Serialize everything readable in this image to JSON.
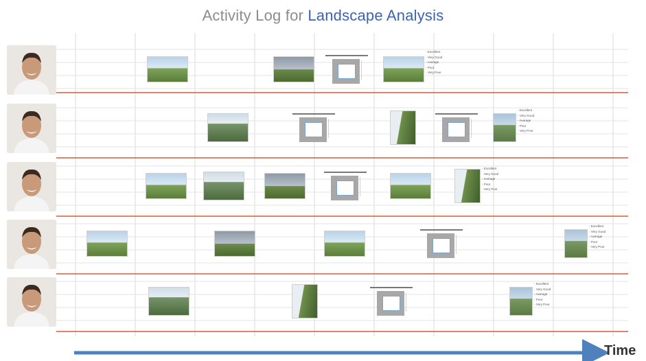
{
  "title": {
    "prefix": "Activity Log for ",
    "highlight": "Landscape Analysis"
  },
  "time_label": "Time",
  "colors": {
    "title_gray": "#8c8c8c",
    "title_blue": "#3a64b0",
    "separator_red": "#d9583b",
    "time_arrow": "#4f81bd",
    "grid": "#d9d9d9"
  },
  "rating_options": [
    "Excellent",
    "Very Good",
    "Average",
    "Poor",
    "Very Poor"
  ],
  "rows": [
    {
      "avatar": "man-smiling-avatar",
      "items": [
        {
          "kind": "photo",
          "scene": "land"
        },
        {
          "kind": "photo",
          "scene": "rain"
        },
        {
          "kind": "form"
        },
        {
          "kind": "photo",
          "scene": "land",
          "rating": true
        }
      ]
    },
    {
      "avatar": "woman-blonde-avatar",
      "items": [
        {
          "kind": "photo",
          "scene": "rock"
        },
        {
          "kind": "form"
        },
        {
          "kind": "photo",
          "scene": "cliff"
        },
        {
          "kind": "form"
        },
        {
          "kind": "photo",
          "scene": "vert",
          "rating": true
        }
      ]
    },
    {
      "avatar": "man-bearded-avatar",
      "items": [
        {
          "kind": "photo",
          "scene": "land"
        },
        {
          "kind": "photo",
          "scene": "rock"
        },
        {
          "kind": "photo",
          "scene": "rain"
        },
        {
          "kind": "form"
        },
        {
          "kind": "photo",
          "scene": "land"
        },
        {
          "kind": "photo",
          "scene": "cliff",
          "rating": true
        }
      ]
    },
    {
      "avatar": "woman-curly-avatar",
      "items": [
        {
          "kind": "photo",
          "scene": "land"
        },
        {
          "kind": "photo",
          "scene": "rain"
        },
        {
          "kind": "photo",
          "scene": "land"
        },
        {
          "kind": "form"
        },
        {
          "kind": "photo",
          "scene": "vert",
          "rating": true
        }
      ]
    },
    {
      "avatar": "woman-laughing-avatar",
      "items": [
        {
          "kind": "photo",
          "scene": "rock"
        },
        {
          "kind": "photo",
          "scene": "cliff"
        },
        {
          "kind": "form"
        },
        {
          "kind": "photo",
          "scene": "vert",
          "rating": true
        }
      ]
    }
  ]
}
